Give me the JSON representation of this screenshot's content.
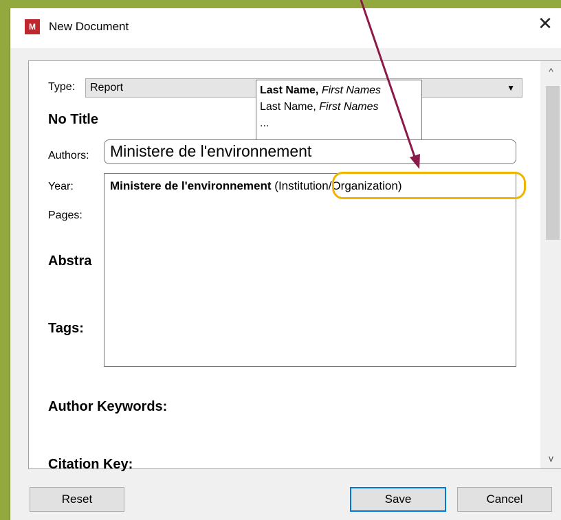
{
  "window": {
    "title": "New Document",
    "logo_text": "M",
    "close_glyph": "✕"
  },
  "form": {
    "type_label": "Type:",
    "type_value": "Report",
    "type_arrow": "▼",
    "title_text": "No Title",
    "authors_label": "Authors:",
    "authors_value": "Ministere de l'environnement",
    "year_label": "Year:",
    "pages_label": "Pages:",
    "abstract_heading": "Abstra",
    "tags_heading": "Tags:",
    "author_keywords_heading": "Author Keywords:",
    "citation_key_heading": "Citation Key:"
  },
  "name_format_popup": {
    "line1_bold": "Last Name,",
    "line1_italic": "First Names",
    "line2_normal": "Last Name,",
    "line2_italic": "First Names",
    "line3": "..."
  },
  "author_suggestions": {
    "item_bold": "Ministere de l'environnement",
    "item_kind": "(Institution/Organization)"
  },
  "scrollbar": {
    "up_glyph": "^",
    "down_glyph": "v"
  },
  "buttons": {
    "reset": "Reset",
    "save": "Save",
    "cancel": "Cancel"
  },
  "colors": {
    "background_green": "#94a840",
    "annotation_arrow": "#8b1a4a",
    "annotation_highlight": "#f0b400",
    "primary_button_border": "#0078d7",
    "logo_red": "#c0272d"
  }
}
